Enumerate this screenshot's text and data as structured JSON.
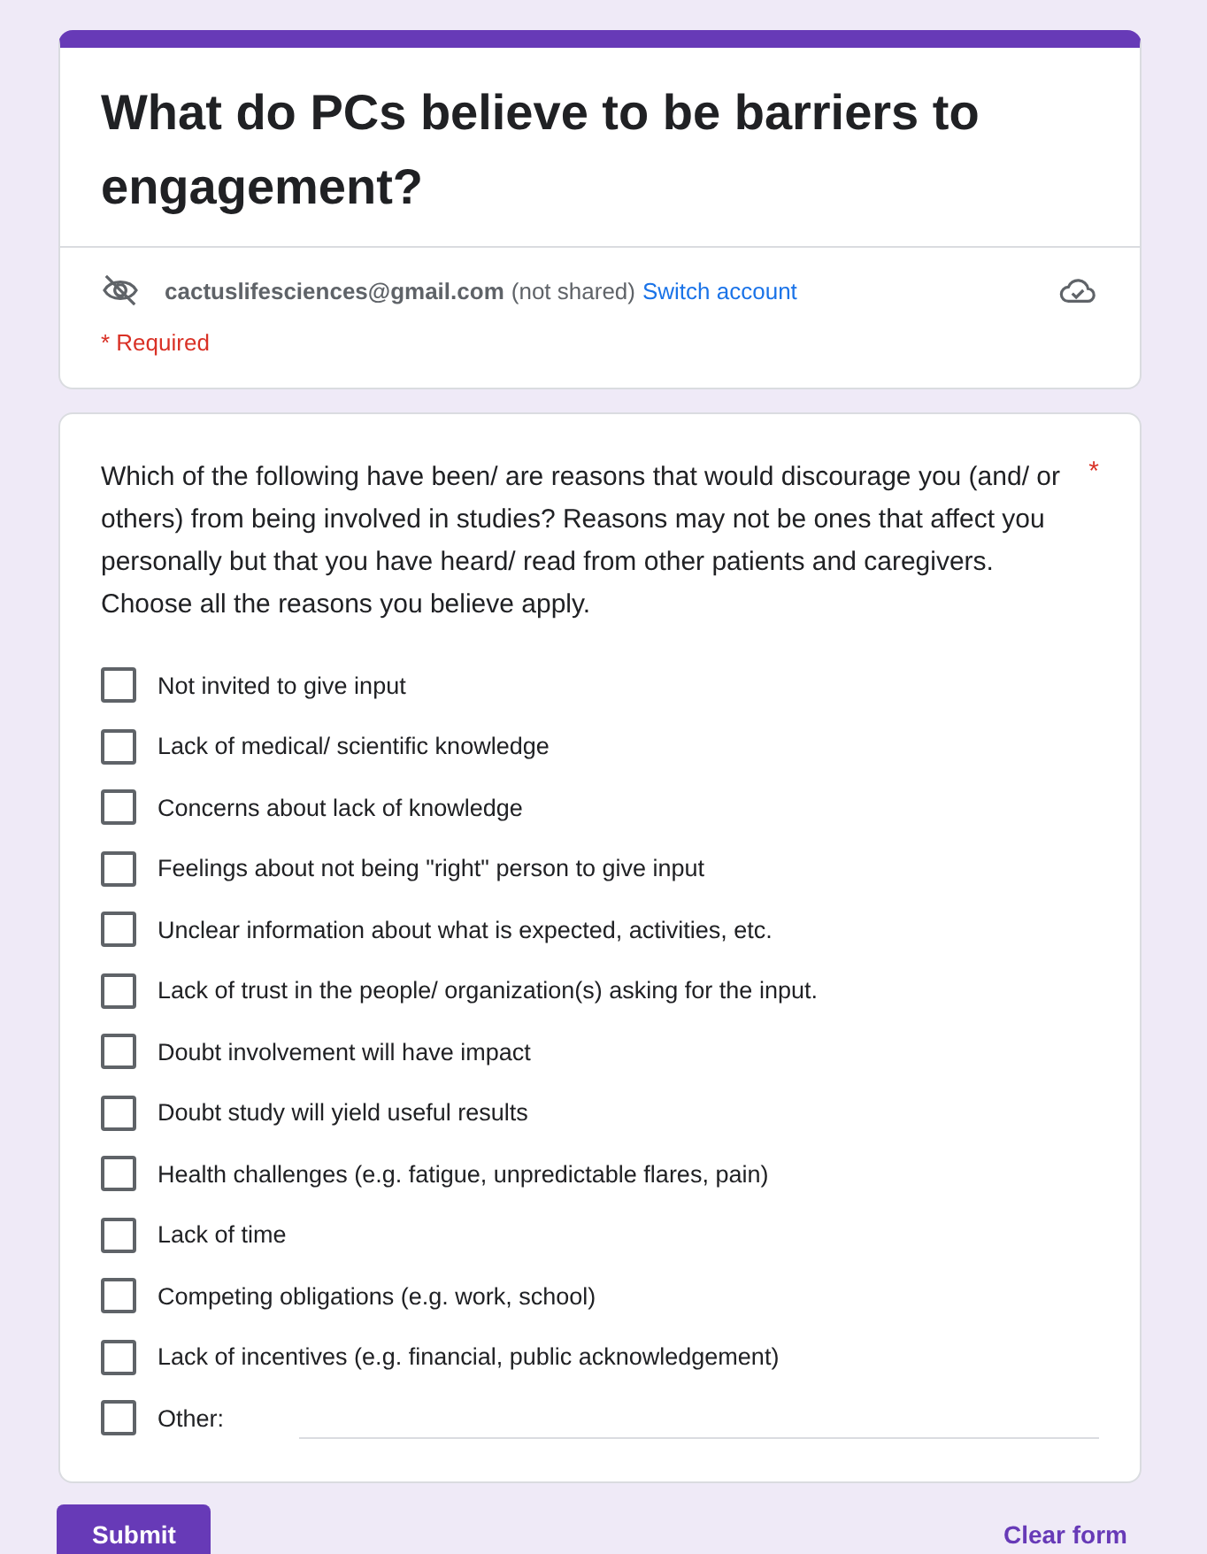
{
  "form": {
    "title": "What do PCs believe to be barriers to engagement?",
    "account": {
      "email": "cactuslifesciences@gmail.com",
      "sharing": "(not shared)",
      "switch_link": "Switch account"
    },
    "required_note": "* Required"
  },
  "question": {
    "text": "Which of the following have been/ are reasons that would discourage you (and/ or others) from being involved in studies? Reasons may not be ones that affect you personally but that you have heard/ read from other patients and caregivers. Choose all the reasons you believe apply.",
    "required_mark": "*",
    "options": [
      {
        "kind": "checkbox",
        "label": "Not invited to give input",
        "checked": false
      },
      {
        "kind": "checkbox",
        "label": "Lack of medical/ scientific knowledge",
        "checked": false
      },
      {
        "kind": "checkbox",
        "label": "Concerns about lack of knowledge",
        "checked": false
      },
      {
        "kind": "checkbox",
        "label": "Feelings about not being \"right\"  person to give input",
        "checked": false
      },
      {
        "kind": "checkbox",
        "label": "Unclear information about what is expected, activities, etc.",
        "checked": false
      },
      {
        "kind": "checkbox",
        "label": "Lack of trust in the people/ organization(s) asking for the input.",
        "checked": false
      },
      {
        "kind": "checkbox",
        "label": "Doubt involvement will have impact",
        "checked": false
      },
      {
        "kind": "checkbox",
        "label": "Doubt study will yield useful results",
        "checked": false
      },
      {
        "kind": "checkbox",
        "label": "Health challenges (e.g. fatigue, unpredictable flares, pain)",
        "checked": false
      },
      {
        "kind": "checkbox",
        "label": "Lack of time",
        "checked": false
      },
      {
        "kind": "checkbox",
        "label": "Competing obligations (e.g. work, school)",
        "checked": false
      },
      {
        "kind": "checkbox",
        "label": "Lack of incentives  (e.g. financial, public acknowledgement)",
        "checked": false
      },
      {
        "kind": "other",
        "label": "Other:",
        "checked": false
      }
    ]
  },
  "actions": {
    "submit": "Submit",
    "clear": "Clear form"
  }
}
